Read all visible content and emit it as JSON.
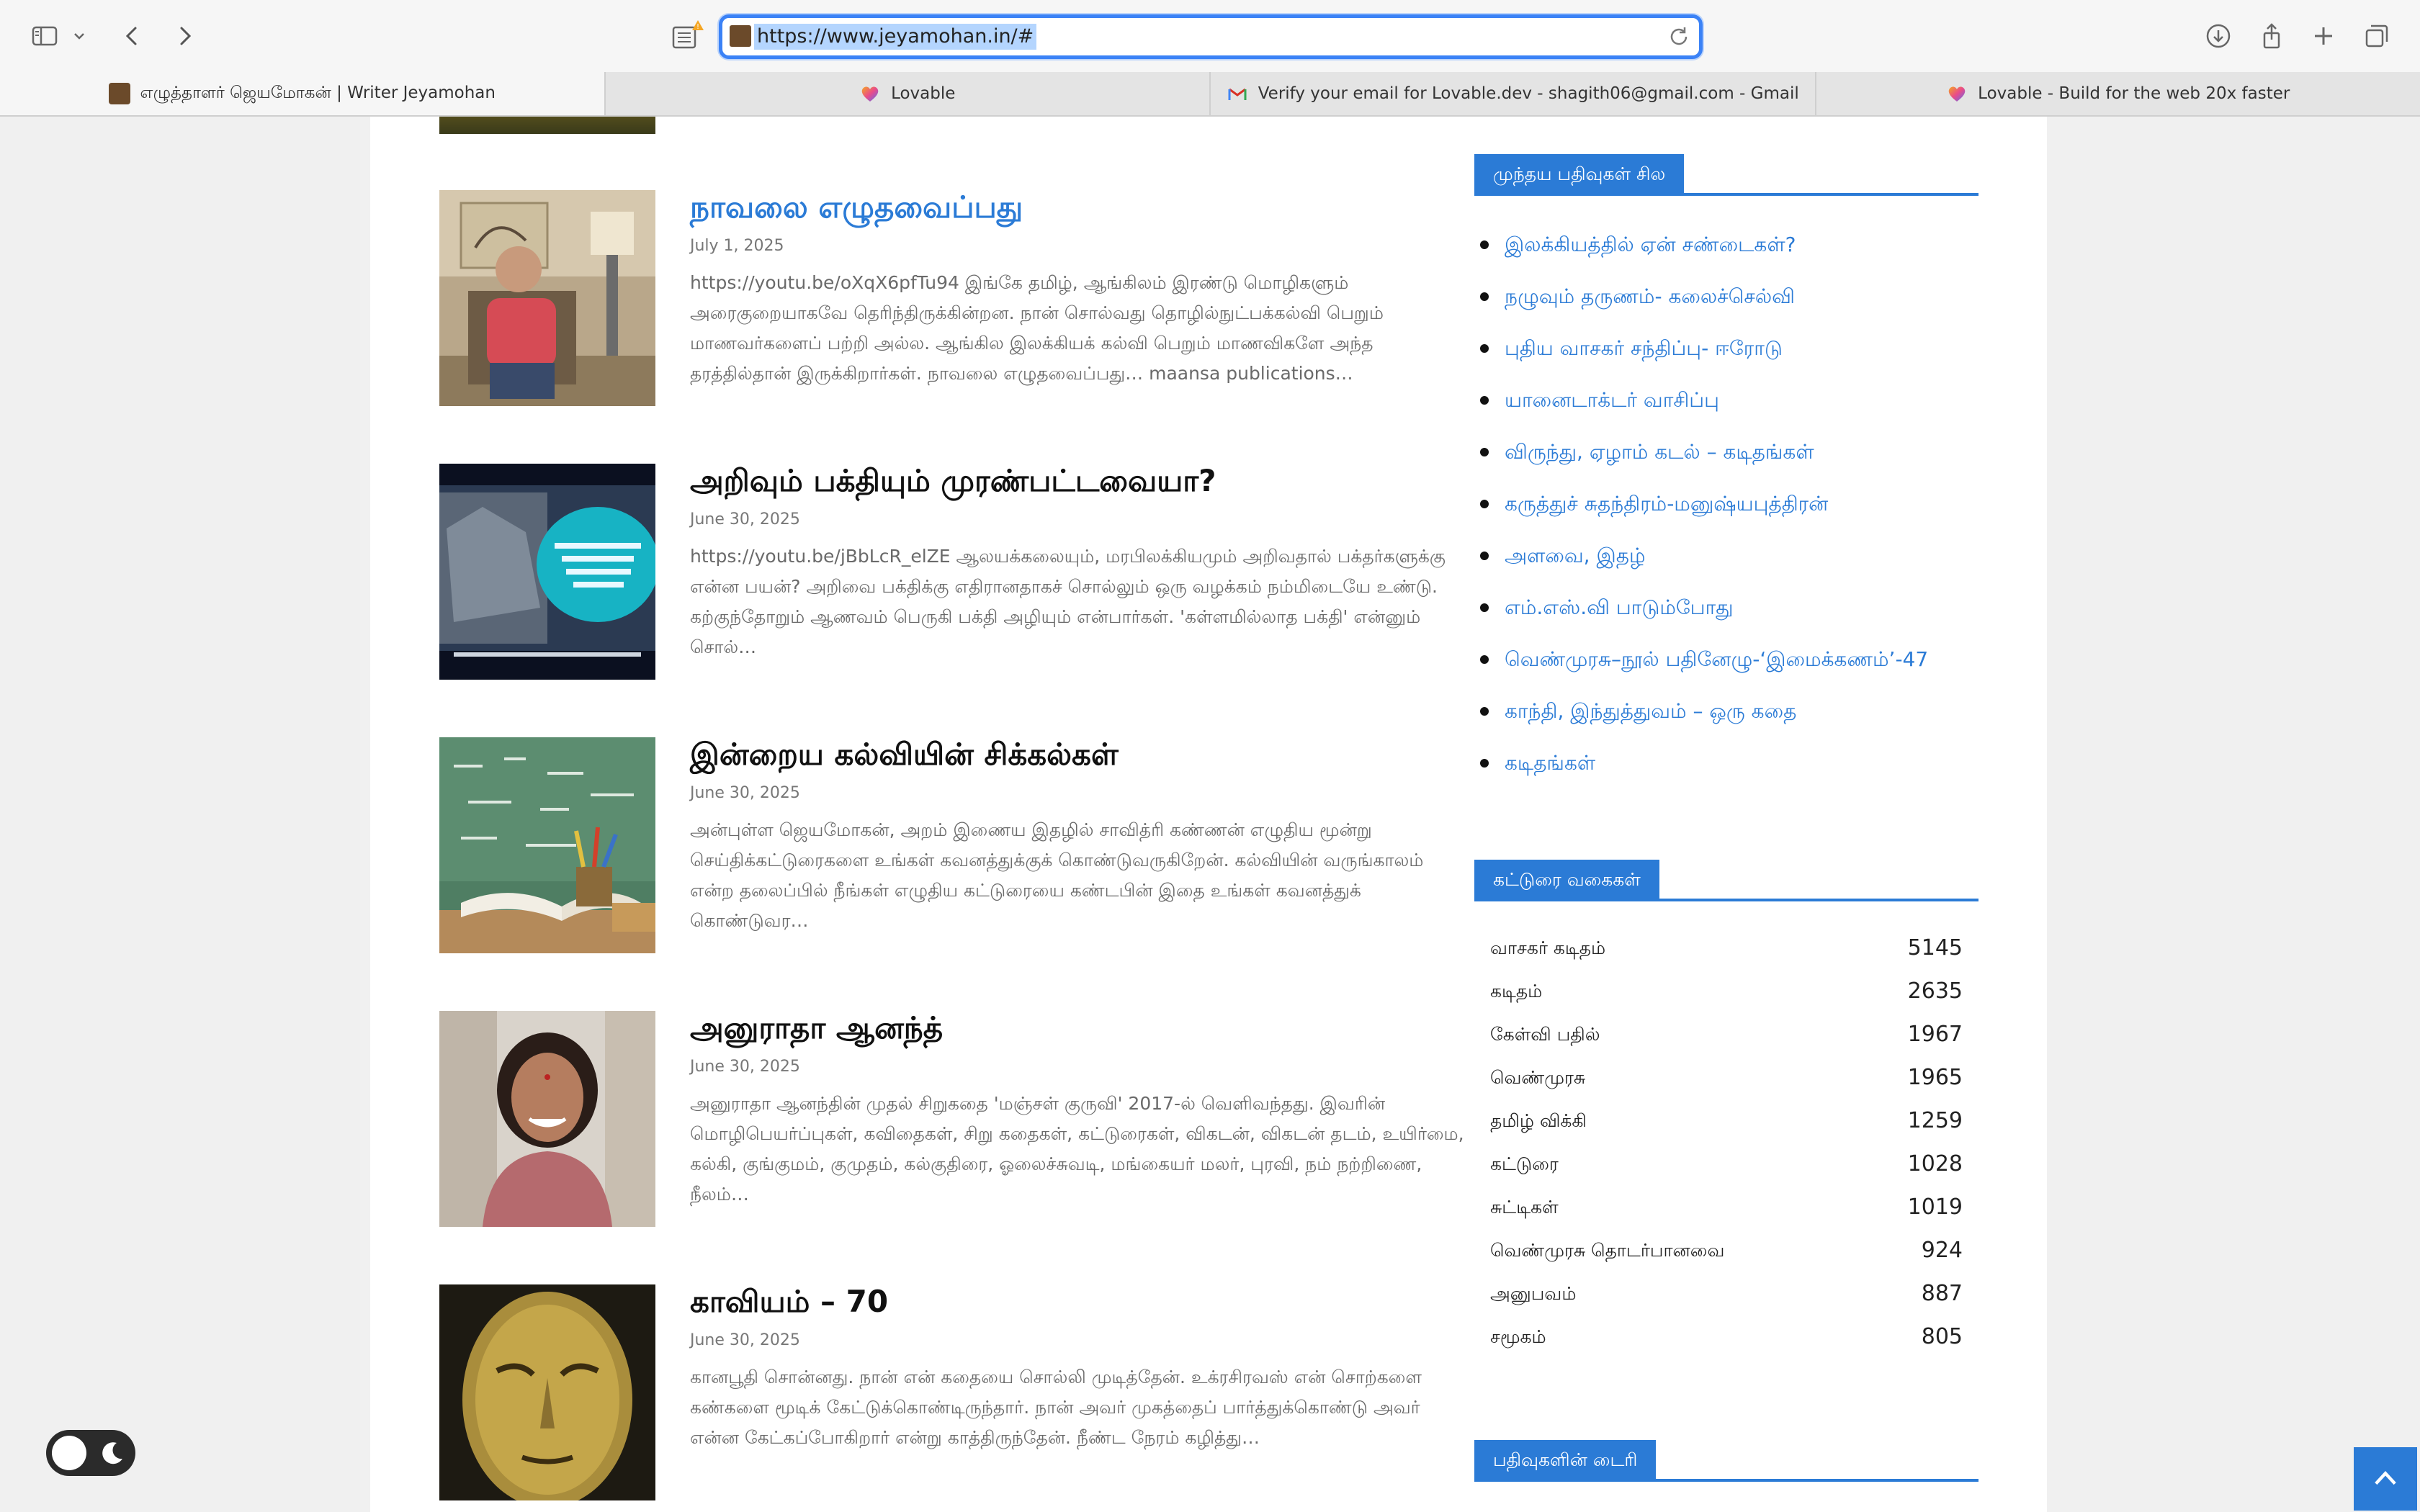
{
  "browser": {
    "url": "https://www.jeyamohan.in/#",
    "tabs": [
      {
        "label": "எழுத்தாளர் ஜெயமோகன் | Writer Jeyamohan",
        "active": true
      },
      {
        "label": "Lovable",
        "active": false
      },
      {
        "label": "Verify your email for Lovable.dev - shagith06@gmail.com - Gmail",
        "active": false
      },
      {
        "label": "Lovable - Build for the web 20x faster",
        "active": false
      }
    ],
    "icons": [
      "sidebar-icon",
      "chevron-down-icon",
      "back-icon",
      "forward-icon",
      "reader-icon",
      "reload-icon",
      "download-icon",
      "share-icon",
      "new-tab-icon",
      "tab-overview-icon"
    ]
  },
  "posts": [
    {
      "title": "நாவலை எழுதவைப்பது",
      "date": "July 1, 2025",
      "excerpt": "https://youtu.be/oXqX6pfTu94 இங்கே தமிழ், ஆங்கிலம் இரண்டு மொழிகளும் அரைகுறையாகவே தெரிந்திருக்கின்றன. நான் சொல்வது தொழில்நுட்பக்கல்வி பெறும் மாணவர்களைப் பற்றி அல்ல. ஆங்கில இலக்கியக் கல்வி பெறும் மாணவிகளே அந்த தரத்தில்தான் இருக்கிறார்கள். நாவலை எழுதவைப்பது… maansa publications…"
    },
    {
      "title": "அறிவும் பக்தியும் முரண்பட்டவையா?",
      "date": "June 30, 2025",
      "excerpt": "https://youtu.be/jBbLcR_elZE ஆலயக்கலையும், மரபிலக்கியமும் அறிவதால் பக்தர்களுக்கு என்ன பயன்? அறிவை பக்திக்கு எதிரானதாகச் சொல்லும் ஒரு வழக்கம் நம்மிடையே உண்டு. கற்குந்தோறும் ஆணவம் பெருகி பக்தி அழியும் என்பார்கள். 'கள்ளமில்லாத பக்தி' என்னும் சொல்…"
    },
    {
      "title": "இன்றைய கல்வியின் சிக்கல்கள்",
      "date": "June 30, 2025",
      "excerpt": "அன்புள்ள ஜெயமோகன், அறம் இணைய இதழில் சாவித்ரி கண்ணன் எழுதிய மூன்று செய்திக்கட்டுரைகளை உங்கள் கவனத்துக்குக் கொண்டுவருகிறேன். கல்வியின் வருங்காலம் என்ற தலைப்பில் நீங்கள் எழுதிய கட்டுரையை கண்டபின் இதை உங்கள் கவனத்துக் கொண்டுவர…"
    },
    {
      "title": "அனுராதா ஆனந்த்",
      "date": "June 30, 2025",
      "excerpt": "அனுராதா ஆனந்தின் முதல் சிறுகதை 'மஞ்சள் குருவி' 2017-ல் வெளிவந்தது. இவரின் மொழிபெயர்ப்புகள், கவிதைகள், சிறு கதைகள், கட்டுரைகள், விகடன், விகடன் தடம், உயிர்மை, கல்கி, குங்குமம், குமுதம், கல்குதிரை, ஓலைச்சுவடி, மங்கையர் மலர், புரவி, நம் நற்றிணை, நீலம்…"
    },
    {
      "title": "காவியம் – 70",
      "date": "June 30, 2025",
      "excerpt": "கானபூதி சொன்னது. நான் என் கதையை சொல்லி முடித்தேன். உக்ரசிரவஸ் என் சொற்களை கண்களை மூடிக் கேட்டுக்கொண்டிருந்தார். நான் அவர் முகத்தைப் பார்த்துக்கொண்டு அவர் என்ன கேட்கப்போகிறார் என்று காத்திருந்தேன். நீண்ட நேரம் கழித்து…"
    }
  ],
  "sidebar": {
    "recent_heading": "முந்தய பதிவுகள் சில",
    "recent": [
      "இலக்கியத்தில் ஏன் சண்டைகள்?",
      "நழுவும் தருணம்- கலைச்செல்வி",
      "புதிய வாசகர் சந்திப்பு- ஈரோடு",
      "யானைடாக்டர் வாசிப்பு",
      "விருந்து, ஏழாம் கடல் – கடிதங்கள்",
      "கருத்துச் சுதந்திரம்-மனுஷ்யபுத்திரன்",
      "அளவை, இதழ்",
      "எம்.எஸ்.வி பாடும்போது",
      "வெண்முரசு–நூல் பதினேழு-‘இமைக்கணம்’-47",
      "காந்தி, இந்துத்துவம் – ஒரு கதை",
      "கடிதங்கள்"
    ],
    "categories_heading": "கட்டுரை வகைகள்",
    "categories": [
      {
        "name": "வாசகர் கடிதம்",
        "count": "5145"
      },
      {
        "name": "கடிதம்",
        "count": "2635"
      },
      {
        "name": "கேள்வி பதில்",
        "count": "1967"
      },
      {
        "name": "வெண்முரசு",
        "count": "1965"
      },
      {
        "name": "தமிழ் விக்கி",
        "count": "1259"
      },
      {
        "name": "கட்டுரை",
        "count": "1028"
      },
      {
        "name": "சுட்டிகள்",
        "count": "1019"
      },
      {
        "name": "வெண்முரசு தொடர்பானவை",
        "count": "924"
      },
      {
        "name": "அனுபவம்",
        "count": "887"
      },
      {
        "name": "சமூகம்",
        "count": "805"
      }
    ],
    "archive_heading": "பதிவுகளின் டைரி"
  },
  "colors": {
    "accent": "#2b7bd6",
    "url_highlight": "#b4d5fe",
    "focus_ring": "#3b82f6"
  }
}
